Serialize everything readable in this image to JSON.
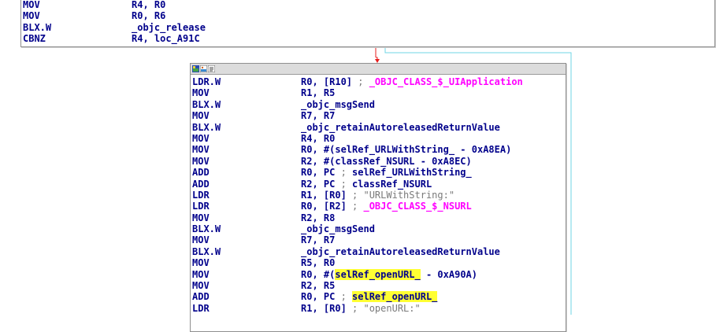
{
  "colors": {
    "mnemonic": "#00008b",
    "operand": "#00008b",
    "class_ref": "#ff00ff",
    "comment": "#7a7a7a",
    "highlight": "#ffff33",
    "edge_red": "#e81c1c",
    "edge_cyan": "#6fd6e6",
    "block_border": "#8f8f8f",
    "titlebar": "#dcdcdc"
  },
  "top_block": {
    "lines": [
      {
        "mnem": "MOV",
        "ops": [
          {
            "t": "R4, R0",
            "k": "reg"
          }
        ]
      },
      {
        "mnem": "MOV",
        "ops": [
          {
            "t": "R0, R6",
            "k": "reg"
          }
        ]
      },
      {
        "mnem": "BLX.W",
        "ops": [
          {
            "t": "_objc_release",
            "k": "sym"
          }
        ]
      },
      {
        "mnem": "CBNZ",
        "ops": [
          {
            "t": "R4, loc_A91C",
            "k": "sym"
          }
        ]
      }
    ]
  },
  "main_block": {
    "title_icons": [
      "graph-color-icon",
      "graph-image-icon",
      "graph-text-icon"
    ],
    "lines": [
      {
        "mnem": "LDR.W",
        "ops": [
          {
            "t": "R0, [R10] ",
            "k": "reg"
          },
          {
            "t": "; ",
            "k": "cmt"
          },
          {
            "t": "_OBJC_CLASS_$_UIApplication",
            "k": "class"
          }
        ]
      },
      {
        "mnem": "MOV",
        "ops": [
          {
            "t": "R1, R5",
            "k": "reg"
          }
        ]
      },
      {
        "mnem": "BLX.W",
        "ops": [
          {
            "t": "_objc_msgSend",
            "k": "sym"
          }
        ]
      },
      {
        "mnem": "MOV",
        "ops": [
          {
            "t": "R7, R7",
            "k": "reg"
          }
        ]
      },
      {
        "mnem": "BLX.W",
        "ops": [
          {
            "t": "_objc_retainAutoreleasedReturnValue",
            "k": "sym"
          }
        ]
      },
      {
        "mnem": "MOV",
        "ops": [
          {
            "t": "R4, R0",
            "k": "reg"
          }
        ]
      },
      {
        "mnem": "MOV",
        "ops": [
          {
            "t": "R0, #(selRef_URLWithString_ - 0xA8EA)",
            "k": "reg"
          }
        ]
      },
      {
        "mnem": "MOV",
        "ops": [
          {
            "t": "R2, #(classRef_NSURL - 0xA8EC)",
            "k": "reg"
          }
        ]
      },
      {
        "mnem": "ADD",
        "ops": [
          {
            "t": "R0, PC ",
            "k": "reg"
          },
          {
            "t": "; ",
            "k": "cmt"
          },
          {
            "t": "selRef_URLWithString_",
            "k": "sym"
          }
        ]
      },
      {
        "mnem": "ADD",
        "ops": [
          {
            "t": "R2, PC ",
            "k": "reg"
          },
          {
            "t": "; ",
            "k": "cmt"
          },
          {
            "t": "classRef_NSURL",
            "k": "sym"
          }
        ]
      },
      {
        "mnem": "LDR",
        "ops": [
          {
            "t": "R1, [R0] ",
            "k": "reg"
          },
          {
            "t": "; \"URLWithString:\"",
            "k": "str"
          }
        ]
      },
      {
        "mnem": "LDR",
        "ops": [
          {
            "t": "R0, [R2] ",
            "k": "reg"
          },
          {
            "t": "; ",
            "k": "cmt"
          },
          {
            "t": "_OBJC_CLASS_$_NSURL",
            "k": "class"
          }
        ]
      },
      {
        "mnem": "MOV",
        "ops": [
          {
            "t": "R2, R8",
            "k": "reg"
          }
        ]
      },
      {
        "mnem": "BLX.W",
        "ops": [
          {
            "t": "_objc_msgSend",
            "k": "sym"
          }
        ]
      },
      {
        "mnem": "MOV",
        "ops": [
          {
            "t": "R7, R7",
            "k": "reg"
          }
        ]
      },
      {
        "mnem": "BLX.W",
        "ops": [
          {
            "t": "_objc_retainAutoreleasedReturnValue",
            "k": "sym"
          }
        ]
      },
      {
        "mnem": "MOV",
        "ops": [
          {
            "t": "R5, R0",
            "k": "reg"
          }
        ]
      },
      {
        "mnem": "MOV",
        "ops": [
          {
            "t": "R0, #(",
            "k": "reg"
          },
          {
            "t": "selRef_op",
            "k": "hl"
          },
          {
            "t": "|",
            "k": "caret"
          },
          {
            "t": "enURL_",
            "k": "hl"
          },
          {
            "t": " - 0xA90A)",
            "k": "reg"
          }
        ]
      },
      {
        "mnem": "MOV",
        "ops": [
          {
            "t": "R2, R5",
            "k": "reg"
          }
        ]
      },
      {
        "mnem": "ADD",
        "ops": [
          {
            "t": "R0, PC ",
            "k": "reg"
          },
          {
            "t": "; ",
            "k": "cmt"
          },
          {
            "t": "selRef_openURL_",
            "k": "hl"
          }
        ]
      },
      {
        "mnem": "LDR",
        "ops": [
          {
            "t": "R1, [R0] ",
            "k": "reg"
          },
          {
            "t": "; \"openURL:\"",
            "k": "str"
          }
        ]
      }
    ]
  }
}
